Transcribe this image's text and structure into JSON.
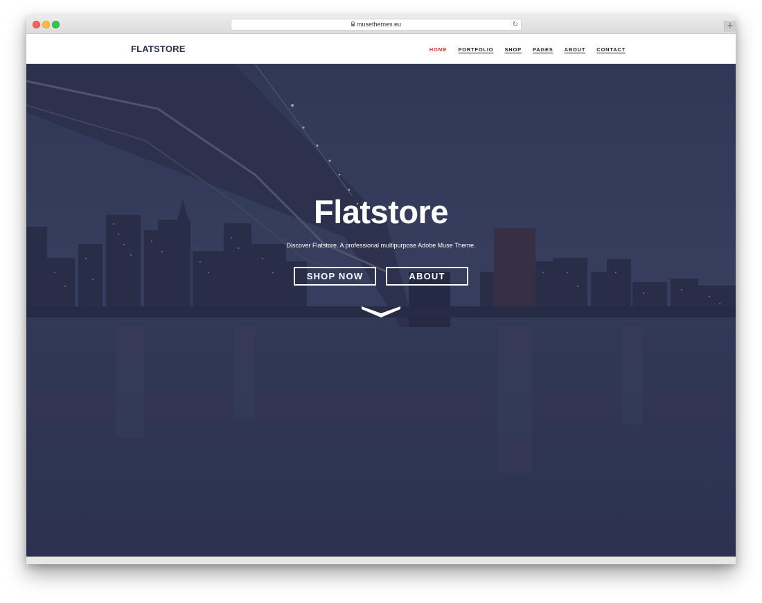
{
  "browser": {
    "url": "musethemes.eu",
    "new_tab_symbol": "+",
    "reload_symbol": "↻"
  },
  "header": {
    "logo": "FLATSTORE",
    "nav": [
      {
        "label": "HOME",
        "active": true
      },
      {
        "label": "PORTFOLIO",
        "active": false
      },
      {
        "label": "SHOP",
        "active": false
      },
      {
        "label": "PAGES",
        "active": false
      },
      {
        "label": "ABOUT",
        "active": false
      },
      {
        "label": "CONTACT",
        "active": false
      }
    ]
  },
  "hero": {
    "title": "Flatstore",
    "subtitle": "Discover Flatstore. A professional multipurpose Adobe Muse Theme.",
    "shop_button": "SHOP NOW",
    "about_button": "ABOUT"
  },
  "colors": {
    "accent": "#c0392b",
    "hero_overlay": "#2e3553",
    "logo": "#2a3149"
  },
  "icons": {
    "scroll_down": "chevron-down-icon",
    "secure": "lock-icon",
    "reload": "reload-icon"
  }
}
